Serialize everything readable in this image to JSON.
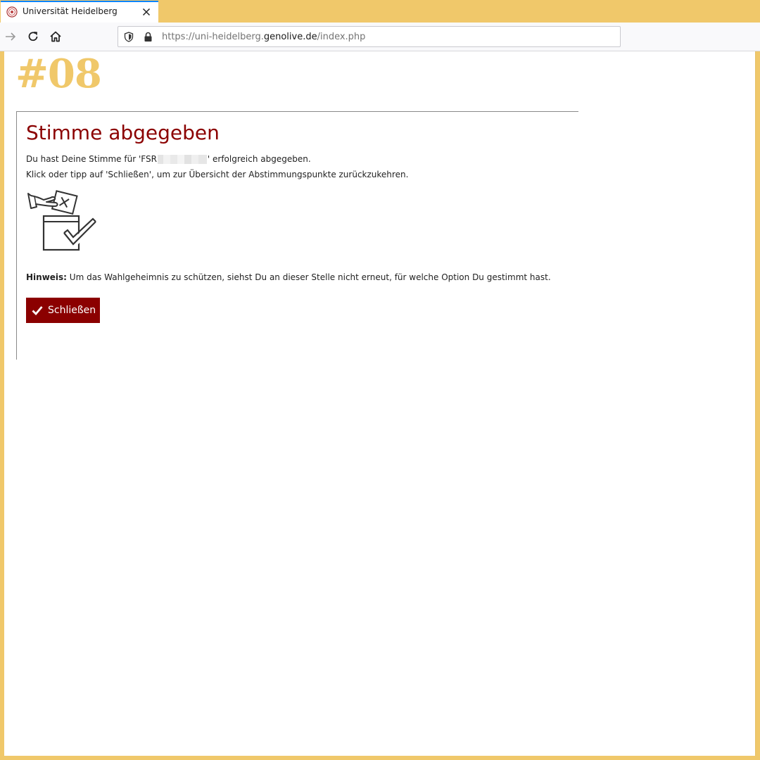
{
  "browser": {
    "tab_title": "Universität Heidelberg",
    "url": {
      "prefix": "https://uni-heidelberg.",
      "domain": "genolive.de",
      "path": "/index.php"
    }
  },
  "page": {
    "badge": "#08",
    "title": "Stimme abgegeben",
    "message_part1": "Du hast Deine Stimme für 'FSR",
    "message_part2": "' erfolgreich abgegeben.",
    "instruction": "Klick oder tipp auf 'Schließen', um zur Übersicht der Abstimmungspunkte zurückzukehren.",
    "hint_label": "Hinweis:",
    "hint_text": " Um das Wahlgeheimnis zu schützen, siehst Du an dieser Stelle nicht erneut, für welche Option Du gestimmt hast.",
    "close_button_label": "Schließen",
    "illustration_icon": "ballot-box-icon"
  },
  "colors": {
    "accent": "#8b0000",
    "chrome_yellow": "#f0c86a",
    "badge": "#f0c86a"
  }
}
